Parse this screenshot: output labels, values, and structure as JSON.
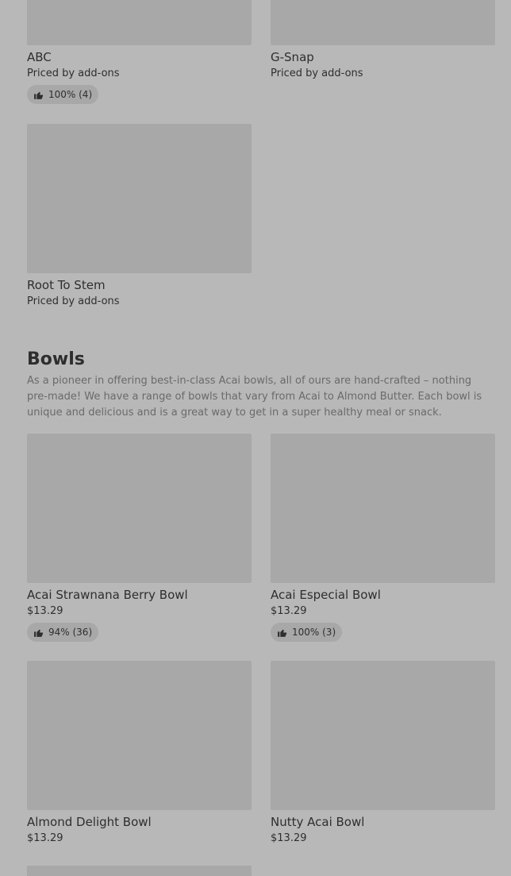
{
  "prev_items": [
    {
      "name": "ABC",
      "price": "Priced by add-ons",
      "rating": "100% (4)"
    },
    {
      "name": "G-Snap",
      "price": "Priced by add-ons"
    },
    {
      "name": "Root To Stem",
      "price": "Priced by add-ons"
    }
  ],
  "bowls": {
    "title": "Bowls",
    "description": "As a pioneer in offering best-in-class Acai bowls, all of ours are hand-crafted – nothing pre-made! We have a range of bowls that vary from Acai to Almond Butter. Each bowl is unique and delicious and is a great way to get in a super healthy meal or snack.",
    "items": [
      {
        "name": "Acai Strawnana Berry Bowl",
        "price": "$13.29",
        "rating": "94% (36)"
      },
      {
        "name": "Acai Especial Bowl",
        "price": "$13.29",
        "rating": "100% (3)"
      },
      {
        "name": "Almond Delight Bowl",
        "price": "$13.29"
      },
      {
        "name": "Nutty Acai Bowl",
        "price": "$13.29"
      }
    ]
  },
  "icons": {
    "rating": "thumbs-up-icon"
  },
  "colors": {
    "placeholder": "#a8a8a8",
    "text": "#2e2e2e",
    "muted_text": "#6a6a6a",
    "background": "#b8b8b8"
  }
}
